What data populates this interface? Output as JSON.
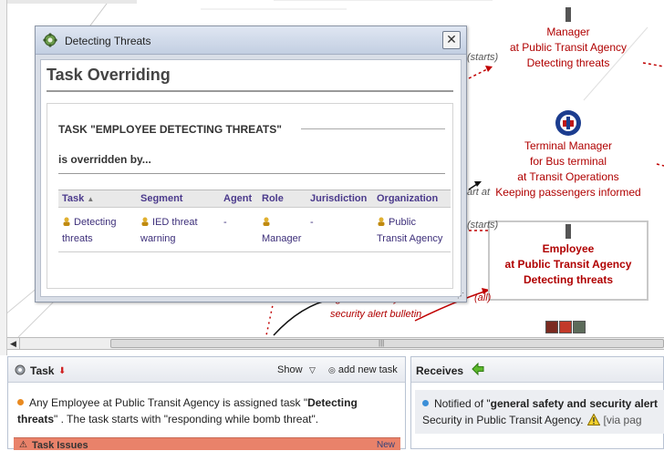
{
  "diagram": {
    "nodes": [
      {
        "id": "manager",
        "lines": [
          "Manager",
          "at Public Transit Agency",
          "Detecting threats"
        ]
      },
      {
        "id": "terminal-manager",
        "lines": [
          "Terminal Manager",
          "for Bus terminal",
          "at Transit Operations",
          "Keeping passengers informed"
        ]
      },
      {
        "id": "employee",
        "lines": [
          "Employee",
          "at Public Transit Agency",
          "Detecting threats"
        ]
      }
    ],
    "edge_labels": {
      "starts_top": "(starts)",
      "starts_mid": "(starts)",
      "start_at": "art at",
      "all": "(all)",
      "bulletin_line1": "general safety and",
      "bulletin_line2": "security alert bulletin"
    }
  },
  "popup": {
    "title": "Detecting Threats",
    "heading": "Task Overriding",
    "panel_title": "TASK \"EMPLOYEE DETECTING THREATS\"",
    "panel_subtitle": "is overridden by...",
    "columns": [
      "Task",
      "Segment",
      "Agent",
      "Role",
      "Jurisdiction",
      "Organization"
    ],
    "rows": [
      {
        "task": "Detecting threats",
        "segment": "IED threat warning",
        "agent": "-",
        "role": "Manager",
        "jurisdiction": "-",
        "organization": "Public Transit Agency"
      }
    ]
  },
  "task_panel": {
    "title": "Task",
    "show_label": "Show",
    "add_new_label": "add new task",
    "description_pre": "Any Employee at Public Transit Agency is assigned task \"",
    "description_bold": "Detecting threats",
    "description_post": "\" . The task starts with \"responding while bomb threat\".",
    "issues_label": "Task Issues",
    "issues_new": "New"
  },
  "receives_panel": {
    "title": "Receives",
    "msg_pre": "Notified of \"",
    "msg_bold": "general safety and security alert",
    "msg_line2": "Security in Public Transit Agency.",
    "msg_via": "[via pag"
  },
  "colors": {
    "node_text": "#b00000",
    "link": "#3d2f7a",
    "issues_bar": "#e9826a"
  }
}
